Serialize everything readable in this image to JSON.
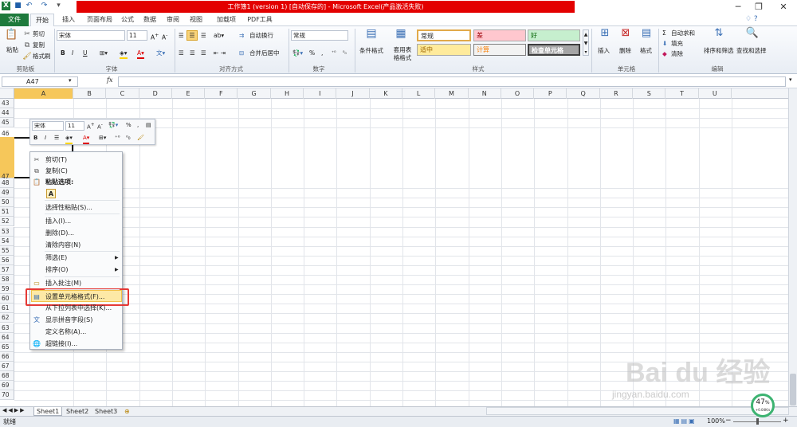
{
  "window": {
    "title": "工作簿1 (version 1) [自动保存的] - Microsoft Excel(产品激活失败)"
  },
  "tabs": [
    "文件",
    "开始",
    "插入",
    "页面布局",
    "公式",
    "数据",
    "审阅",
    "视图",
    "加载项",
    "PDF工具"
  ],
  "ribbon": {
    "clipboard": {
      "paste": "粘贴",
      "cut": "剪切",
      "copy": "复制",
      "format_painter": "格式刷",
      "label": "剪贴板"
    },
    "font": {
      "name": "宋体",
      "size": "11",
      "label": "字体",
      "bold": "B",
      "italic": "I",
      "underline": "U"
    },
    "alignment": {
      "wrap": "自动换行",
      "merge": "合并后居中",
      "label": "对齐方式"
    },
    "number": {
      "format": "常规",
      "percent": "%",
      "comma": ",",
      "label": "数字"
    },
    "styles": {
      "conditional": "条件格式",
      "table": "套用表格格式",
      "label": "样式",
      "normal": "常规",
      "bad": "差",
      "good": "好",
      "neutral": "适中",
      "calc": "计算",
      "check": "检查单元格"
    },
    "cells": {
      "insert": "插入",
      "delete": "删除",
      "format": "格式",
      "label": "单元格"
    },
    "editing": {
      "autosum": "自动求和",
      "fill": "填充",
      "clear": "清除",
      "sort": "排序和筛选",
      "find": "查找和选择",
      "label": "编辑"
    }
  },
  "formula_bar": {
    "name_box": "A47",
    "fx": "fx",
    "value": ""
  },
  "columns": [
    "A",
    "B",
    "C",
    "D",
    "E",
    "F",
    "G",
    "H",
    "I",
    "J",
    "K",
    "L",
    "M",
    "N",
    "O",
    "P",
    "Q",
    "R",
    "S",
    "T",
    "U"
  ],
  "rows": [
    "43",
    "44",
    "45",
    "46",
    "47",
    "48",
    "49",
    "50",
    "51",
    "52",
    "53",
    "54",
    "55",
    "56",
    "57",
    "58",
    "59",
    "60",
    "61",
    "62",
    "63",
    "64",
    "65",
    "66",
    "67",
    "68",
    "69",
    "70"
  ],
  "mini_toolbar": {
    "font": "宋体",
    "size": "11",
    "percent": "%",
    "comma": ","
  },
  "context_menu": {
    "cut": "剪切(T)",
    "copy": "复制(C)",
    "paste_options": "粘贴选项:",
    "paste_a": "A",
    "paste_special": "选择性粘贴(S)...",
    "insert": "插入(I)...",
    "delete": "删除(D)...",
    "clear": "清除内容(N)",
    "filter": "筛选(E)",
    "sort": "排序(O)",
    "insert_comment": "插入批注(M)",
    "format_cells": "设置单元格格式(F)...",
    "pick_list": "从下拉列表中选择(K)...",
    "phonetic": "显示拼音字段(S)",
    "define_name": "定义名称(A)...",
    "hyperlink": "超链接(I)..."
  },
  "sheets": [
    "Sheet1",
    "Sheet2",
    "Sheet3"
  ],
  "status": {
    "ready": "就绪",
    "zoom": "100%",
    "minus": "−",
    "plus": "+"
  },
  "progress": {
    "value": "47",
    "unit": "%",
    "speed": "+0.04K/s"
  },
  "watermark": {
    "main": "Bai du 经验",
    "sub": "jingyan.baidu.com"
  }
}
